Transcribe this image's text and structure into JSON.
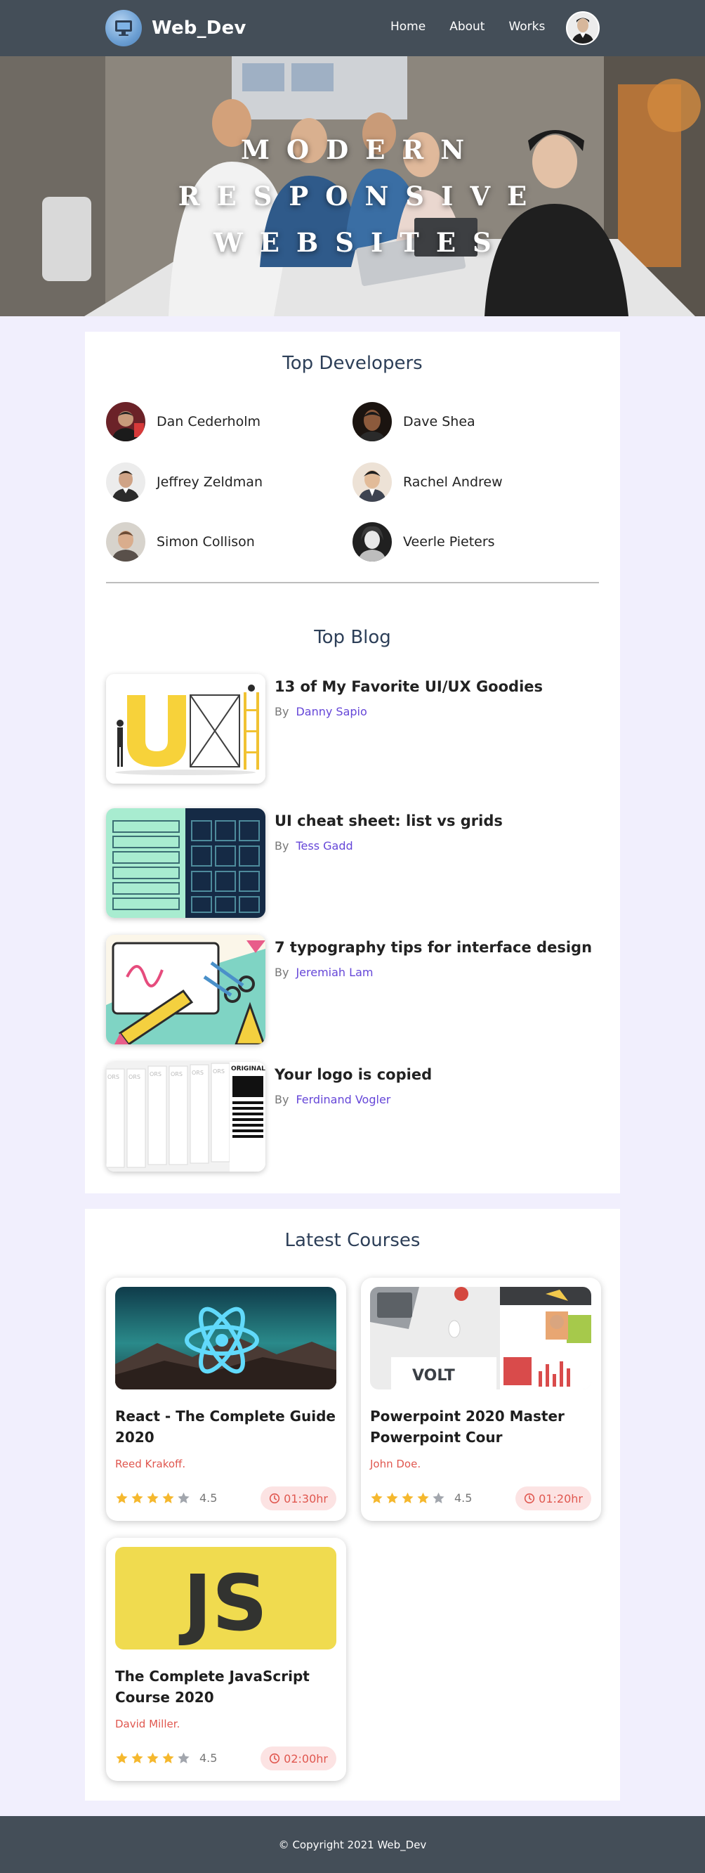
{
  "header": {
    "brand": "Web_Dev",
    "nav": [
      "Home",
      "About",
      "Works"
    ]
  },
  "hero": {
    "title_lines": [
      "MODERN",
      "RESPONSIVE",
      "WEBSITES"
    ]
  },
  "developers": {
    "title": "Top Developers",
    "items": [
      {
        "name": "Dan Cederholm"
      },
      {
        "name": "Dave Shea"
      },
      {
        "name": "Jeffrey Zeldman"
      },
      {
        "name": "Rachel Andrew"
      },
      {
        "name": "Simon Collison"
      },
      {
        "name": "Veerle Pieters"
      }
    ]
  },
  "blog": {
    "title": "Top Blog",
    "by_label": "By",
    "items": [
      {
        "title": "13 of My Favorite UI/UX Goodies",
        "author": "Danny Sapio"
      },
      {
        "title": "UI cheat sheet: list vs grids",
        "author": "Tess Gadd"
      },
      {
        "title": "7 typography tips for interface design",
        "author": "Jeremiah Lam"
      },
      {
        "title": "Your logo is copied",
        "author": "Ferdinand Vogler"
      }
    ],
    "thumb_text": {
      "ux": "UX",
      "volt": "VOLT",
      "orig": "ORIGINAL",
      "ors": "ORS",
      "js": "JS"
    }
  },
  "courses": {
    "title": "Latest Courses",
    "items": [
      {
        "title": "React - The Complete Guide 2020",
        "author": "Reed Krakoff.",
        "rating": "4.5",
        "stars": 4,
        "duration": "01:30hr"
      },
      {
        "title": "Powerpoint 2020 Master Powerpoint Cour",
        "author": "John Doe.",
        "rating": "4.5",
        "stars": 4,
        "duration": "01:20hr"
      },
      {
        "title": "The Complete JavaScript Course 2020",
        "author": "David Miller.",
        "rating": "4.5",
        "stars": 4,
        "duration": "02:00hr"
      }
    ]
  },
  "footer": {
    "copyright": "© Copyright 2021 Web_Dev"
  },
  "colors": {
    "nav_bg": "#444e58",
    "page_bg": "#f1effd",
    "section_title": "#2d3f58",
    "author_link": "#6546d8",
    "course_author": "#e0574f",
    "star_filled": "#f5b82e",
    "star_empty": "#a2a6ad"
  }
}
